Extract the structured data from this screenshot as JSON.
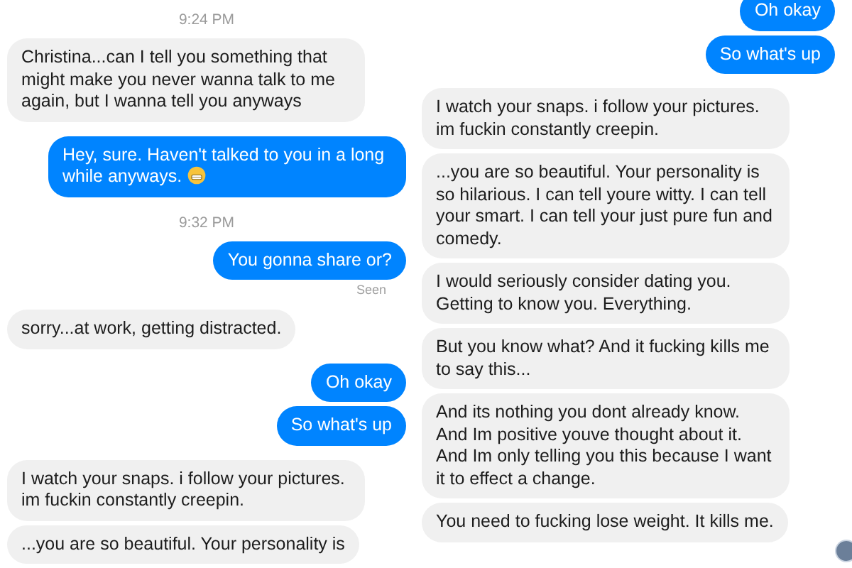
{
  "panels": [
    {
      "messages": [
        {
          "kind": "time",
          "text": "9:24 PM"
        },
        {
          "kind": "incoming",
          "text": "Christina...can I tell you something that might make you never wanna talk to me again, but I wanna tell you anyways"
        },
        {
          "kind": "outgoing",
          "text": "Hey, sure. Haven't talked to you in a long while anyways.",
          "emoji": true
        },
        {
          "kind": "time",
          "text": "9:32 PM"
        },
        {
          "kind": "outgoing",
          "text": "You gonna share or?"
        },
        {
          "kind": "seen",
          "text": "Seen"
        },
        {
          "kind": "incoming",
          "text": "sorry...at work, getting distracted."
        },
        {
          "kind": "outgoing",
          "text": "Oh okay"
        },
        {
          "kind": "outgoing",
          "text": "So what's up"
        },
        {
          "kind": "incoming",
          "text": "I watch your snaps. i follow your pictures. im fuckin constantly creepin."
        },
        {
          "kind": "incoming",
          "text": "...you are so beautiful. Your personality is"
        }
      ]
    },
    {
      "messages": [
        {
          "kind": "outgoing",
          "text": "Oh okay"
        },
        {
          "kind": "outgoing",
          "text": "So what's up"
        },
        {
          "kind": "incoming",
          "text": "I watch your snaps. i follow your pictures. im fuckin constantly creepin."
        },
        {
          "kind": "incoming",
          "text": "...you are so beautiful. Your personality is so hilarious. I can tell youre witty. I can tell your smart. I can tell your just pure fun and comedy."
        },
        {
          "kind": "incoming",
          "text": "I would seriously consider dating you. Getting to know you. Everything."
        },
        {
          "kind": "incoming",
          "text": "But you know what? And it fucking kills me to say this..."
        },
        {
          "kind": "incoming",
          "text": "And its nothing you dont already know. And Im positive youve thought about it. And Im only telling you this because I want it to effect a change."
        },
        {
          "kind": "incoming",
          "text": "You need to fucking lose weight. It kills me."
        },
        {
          "kind": "avatar"
        }
      ]
    }
  ]
}
